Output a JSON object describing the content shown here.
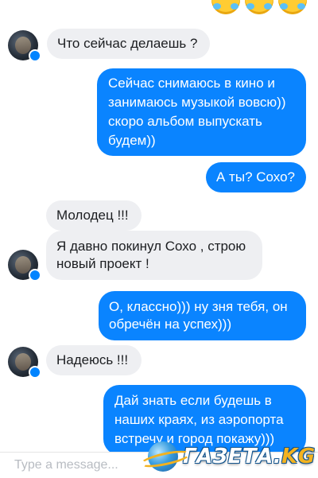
{
  "messages": [
    {
      "side": "in",
      "text": "Что сейчас делаешь ?"
    },
    {
      "side": "out",
      "text": "Сейчас снимаюсь в кино и занимаюсь музыкой вовсю)) скоро альбом выпускать будем))"
    },
    {
      "side": "out",
      "text": "А ты? Сохо?"
    },
    {
      "side": "in",
      "text": "Молодец !!!"
    },
    {
      "side": "in",
      "text": "Я давно покинул Сохо , строю новый проект !"
    },
    {
      "side": "out",
      "text": "О, классно))) ну зня тебя, он обречён на успех)))"
    },
    {
      "side": "in",
      "text": "Надеюсь !!!"
    },
    {
      "side": "out",
      "text": "Дай знать если будешь в наших краях,  из аэропорта встречу и город покажу)))"
    }
  ],
  "composer": {
    "placeholder": "Type a message..."
  },
  "watermark": {
    "text": "ГАЗЕТА.",
    "suffix": "KG"
  },
  "colors": {
    "outgoing": "#0a84ff",
    "incoming": "#eeeff2",
    "messenger_badge": "#0084ff"
  },
  "icons": [
    "laughing-emoji-icon",
    "contact-avatar",
    "messenger-badge-icon"
  ]
}
